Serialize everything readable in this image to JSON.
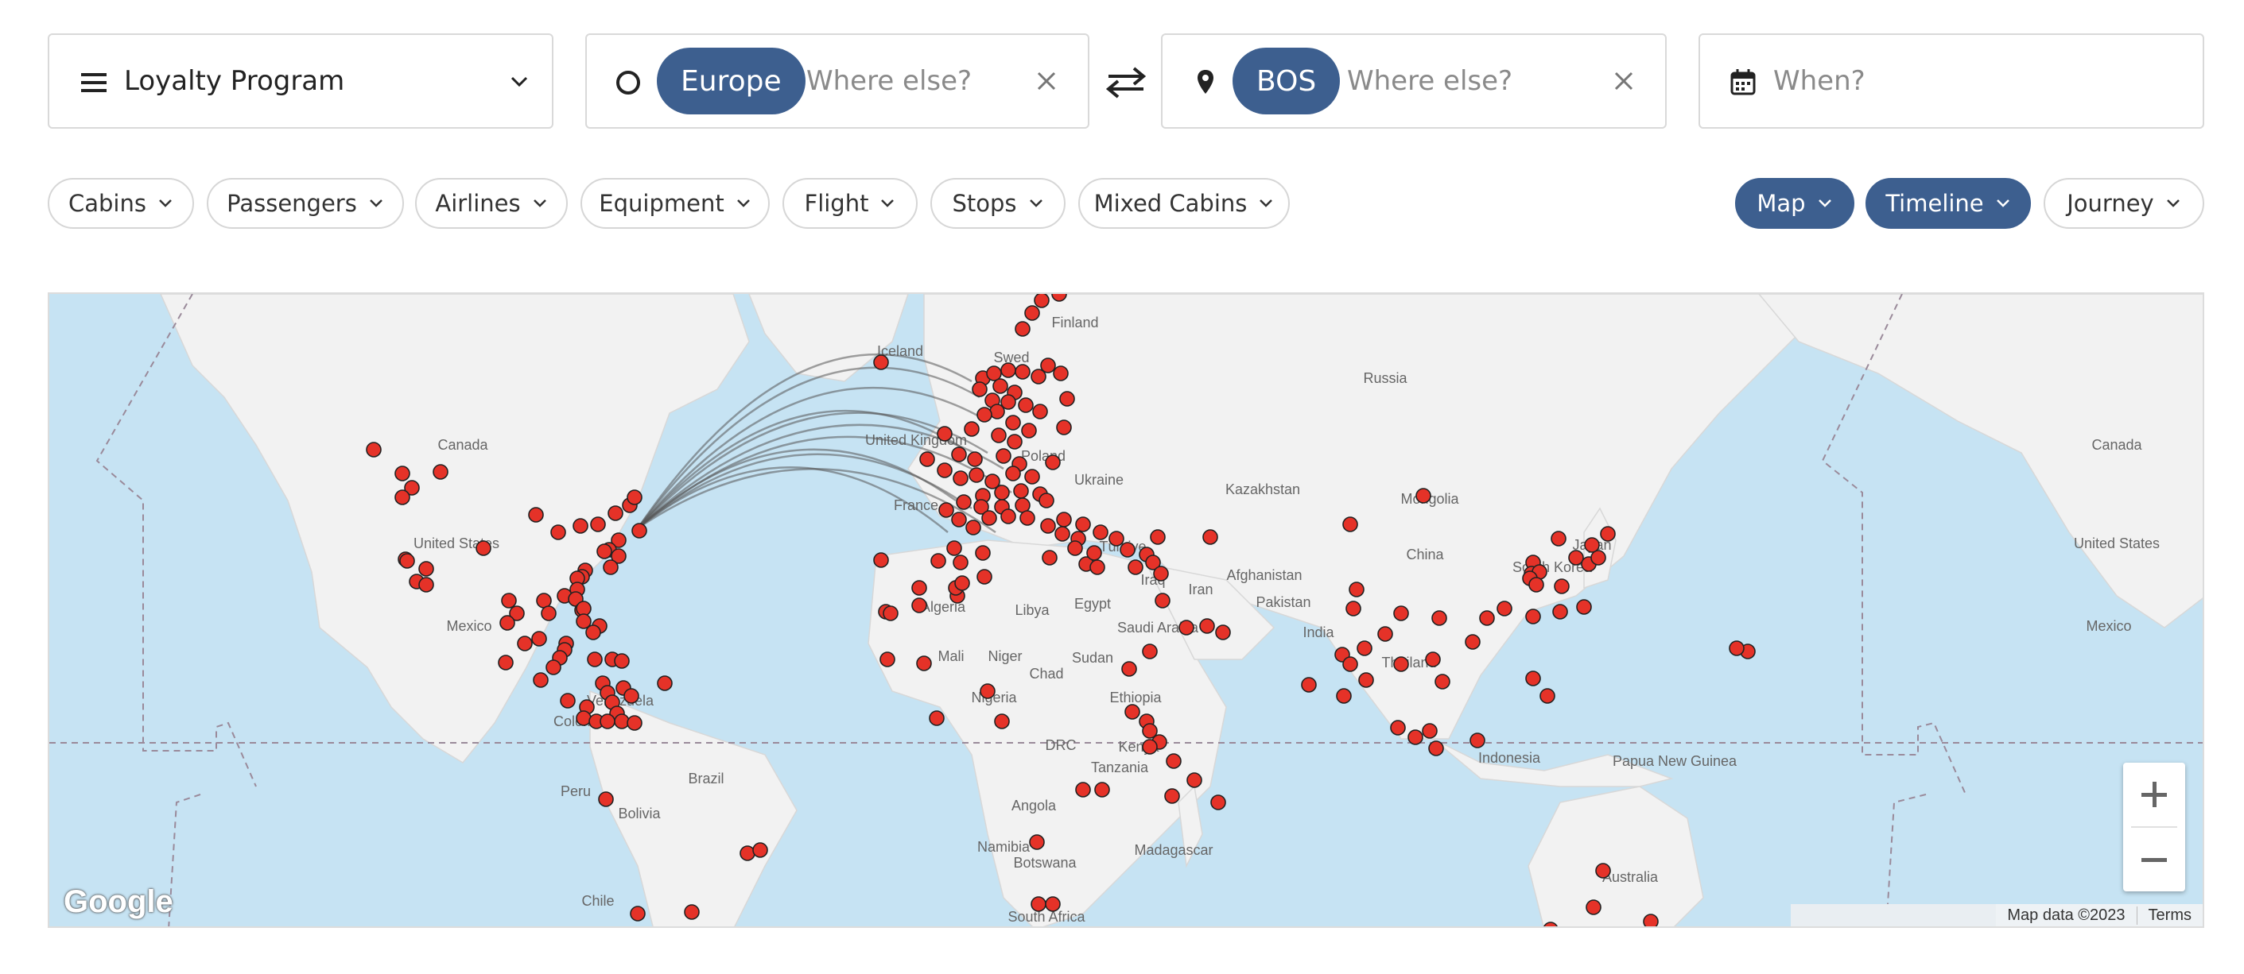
{
  "search": {
    "program": {
      "label": "Loyalty Program",
      "icon": "menu-icon"
    },
    "origin": {
      "chip": "Europe",
      "placeholder": "Where else?"
    },
    "destination": {
      "chip": "BOS",
      "placeholder": "Where else?"
    },
    "date": {
      "placeholder": "When?"
    }
  },
  "filters": [
    "Cabins",
    "Passengers",
    "Airlines",
    "Equipment",
    "Flight",
    "Stops",
    "Mixed Cabins"
  ],
  "views": [
    {
      "label": "Map",
      "active": true
    },
    {
      "label": "Timeline",
      "active": true
    },
    {
      "label": "Journey",
      "active": false
    }
  ],
  "map": {
    "labels": {
      "finland": "Finland",
      "iceland": "Iceland",
      "sweden": "Swed",
      "russia": "Russia",
      "canada_w": "Canada",
      "canada_e": "Canada",
      "uk": "United Kingdom",
      "poland": "Poland",
      "ukraine": "Ukraine",
      "kazakhstan": "Kazakhstan",
      "mongolia": "Mongolia",
      "us_w": "United States",
      "us_e": "United States",
      "france": "France",
      "turkiye": "Türkiye",
      "china": "China",
      "south_korea": "South Korea",
      "japan": "Japan",
      "iraq": "Iraq",
      "iran": "Iran",
      "afghanistan": "Afghanistan",
      "algeria": "Algeria",
      "libya": "Libya",
      "egypt": "Egypt",
      "saudi": "Saudi Arabia",
      "pakistan": "Pakistan",
      "mexico_w": "Mexico",
      "mexico_e": "Mexico",
      "india": "India",
      "thailand": "Thailand",
      "mali": "Mali",
      "niger": "Niger",
      "chad": "Chad",
      "sudan": "Sudan",
      "venezuela": "Venezuela",
      "nigeria": "Nigeria",
      "ethiopia": "Ethiopia",
      "colombia": "Colombia",
      "drc": "DRC",
      "kenya": "Kenya",
      "tanzania": "Tanzania",
      "indonesia": "Indonesia",
      "png": "Papua New Guinea",
      "peru": "Peru",
      "brazil": "Brazil",
      "angola": "Angola",
      "bolivia": "Bolivia",
      "namibia": "Namibia",
      "madagascar": "Madagascar",
      "botswana": "Botswana",
      "australia": "Australia",
      "chile": "Chile",
      "south_africa": "South Africa"
    },
    "attribution": "Map data ©2023",
    "terms": "Terms",
    "logo": "Google"
  },
  "colors": {
    "accent": "#3d5f8f",
    "marker": "#e53228",
    "water": "#c6e3f3",
    "land": "#f2f2f2"
  }
}
